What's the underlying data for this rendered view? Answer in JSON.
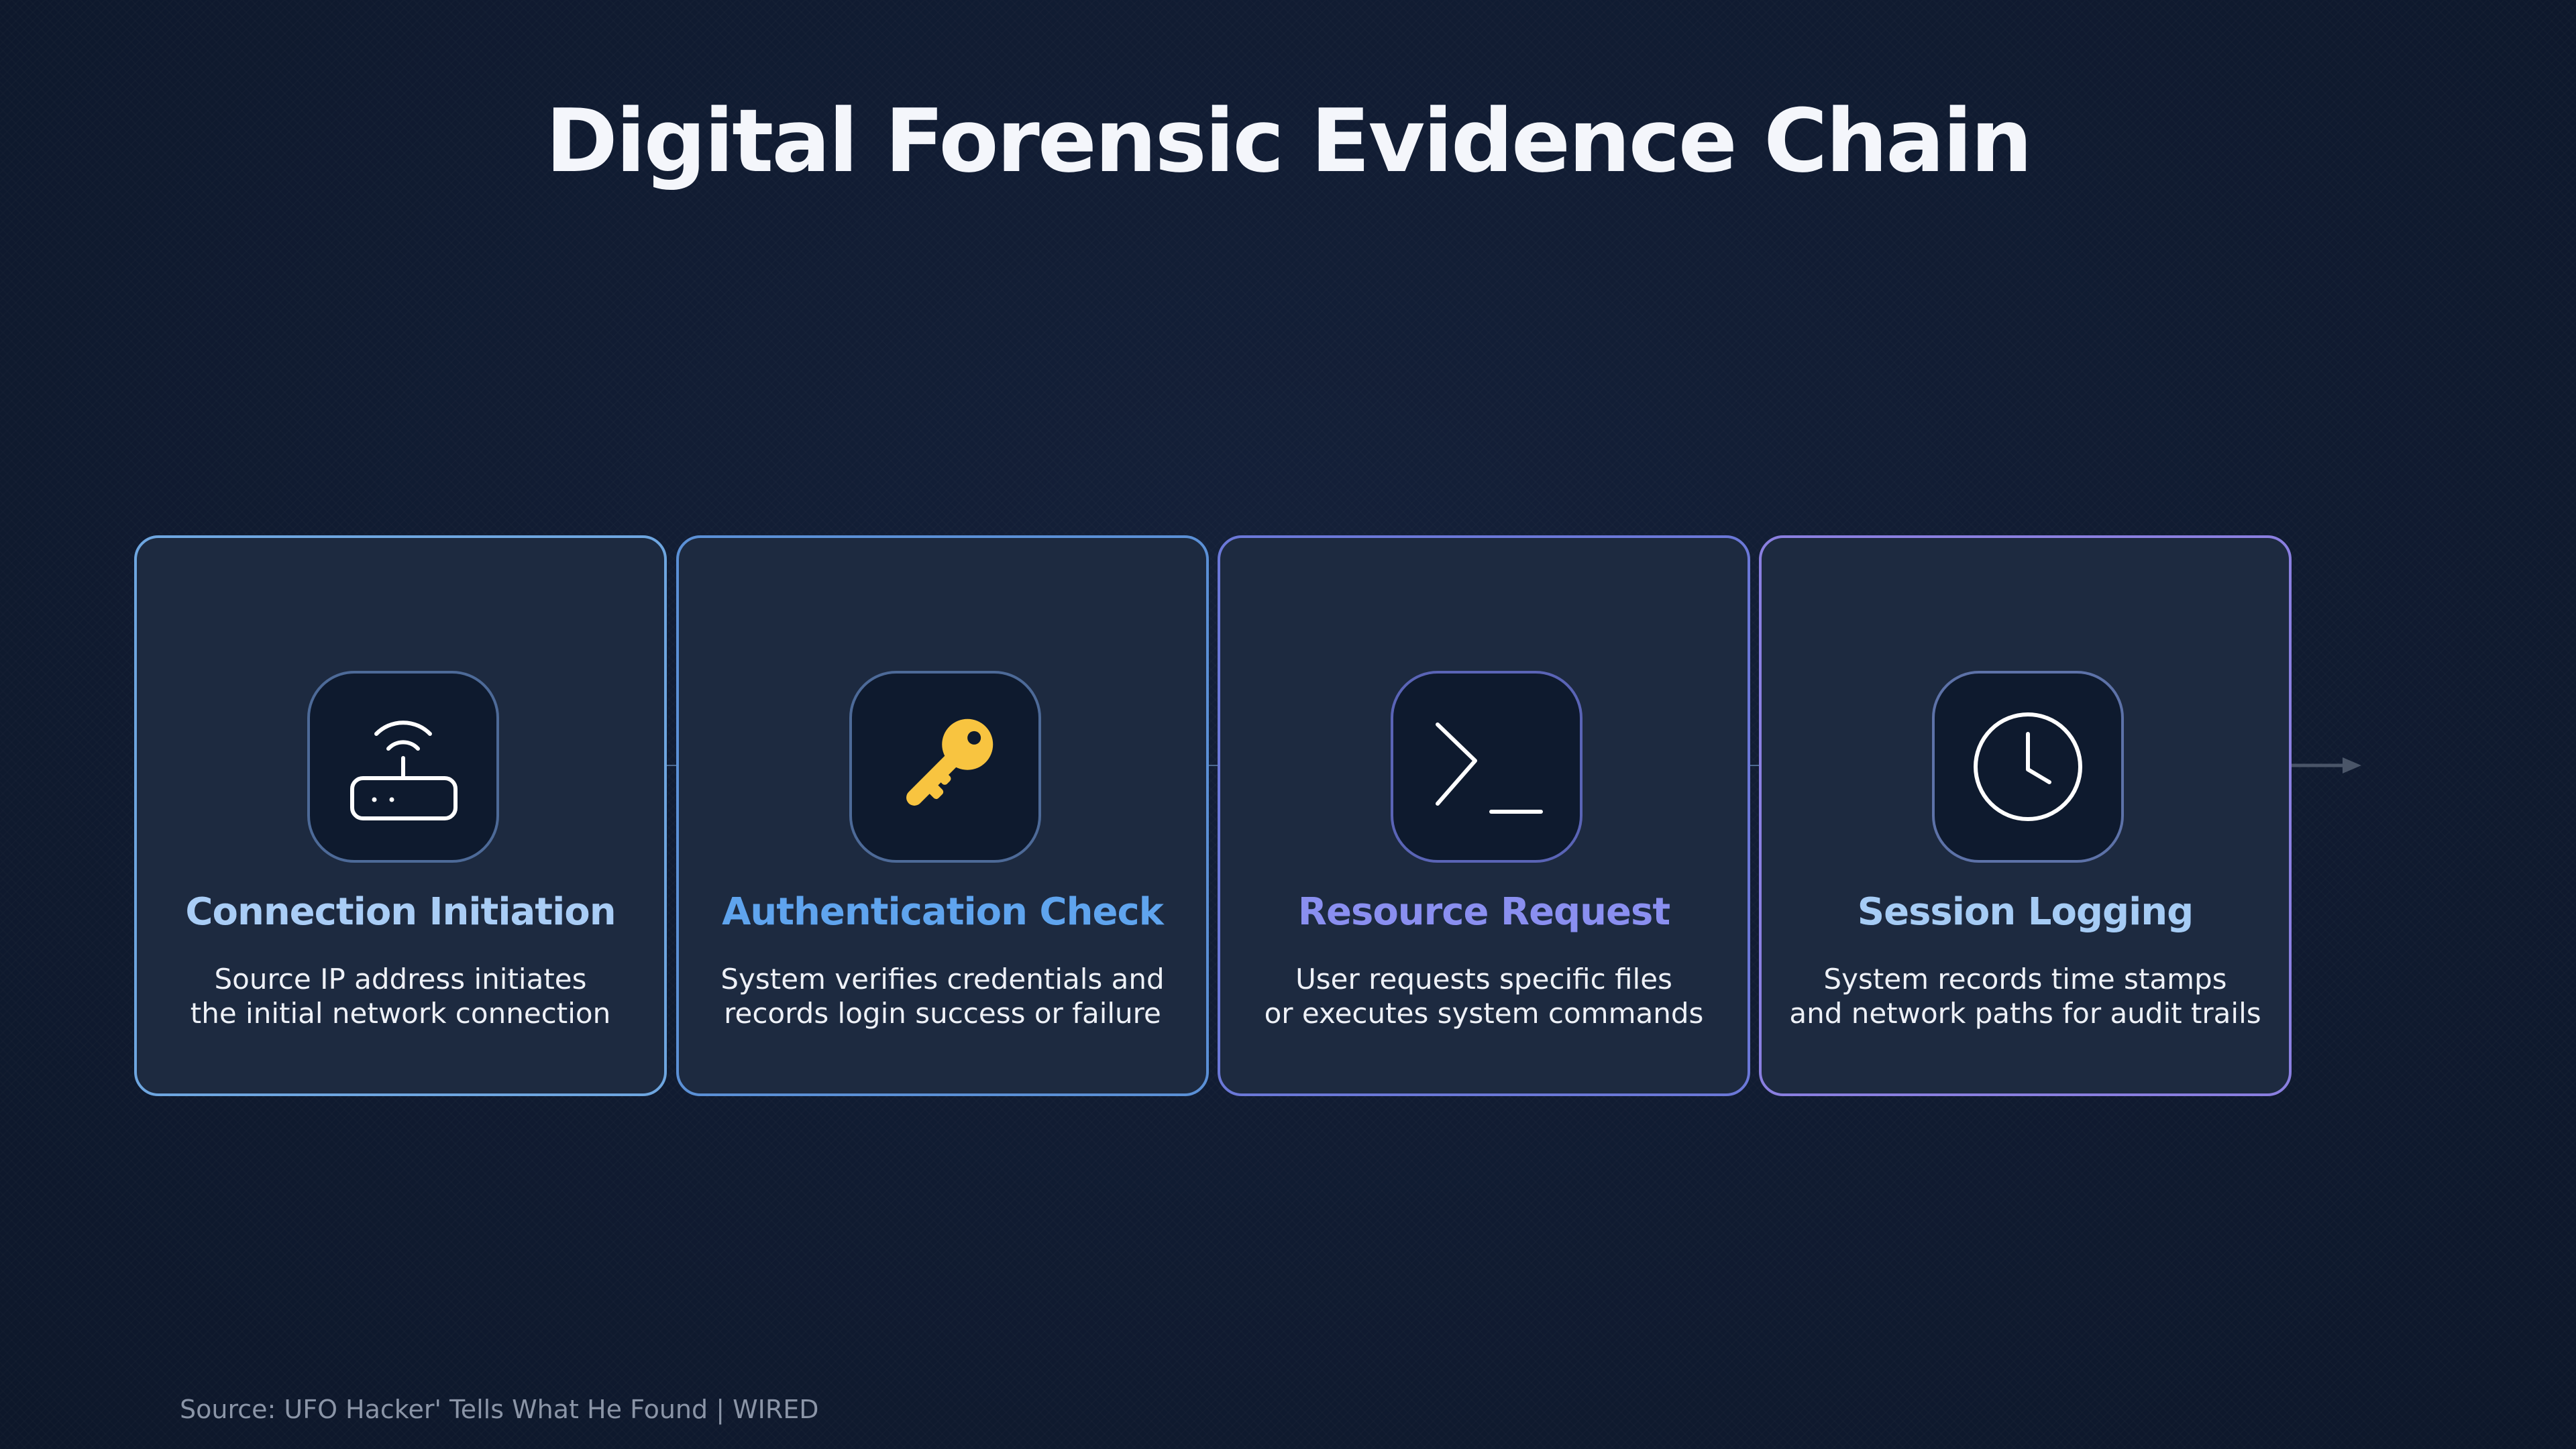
{
  "title": "Digital Forensic Evidence Chain",
  "steps": [
    {
      "icon": "router-icon",
      "title": "Connection Initiation",
      "desc_line1": "Source IP address initiates",
      "desc_line2": "the initial network connection"
    },
    {
      "icon": "key-icon",
      "title": "Authentication Check",
      "desc_line1": "System verifies credentials and",
      "desc_line2": "records login success or failure"
    },
    {
      "icon": "terminal-icon",
      "title": "Resource Request",
      "desc_line1": "User requests specific files",
      "desc_line2": "or executes system commands"
    },
    {
      "icon": "clock-icon",
      "title": "Session Logging",
      "desc_line1": "System records time stamps",
      "desc_line2": "and network paths for audit trails"
    }
  ],
  "source": "Source: UFO Hacker' Tells What He Found | WIRED",
  "colors": {
    "background": "#0f1a2e",
    "card_background": "#1d2a40",
    "key_icon": "#f8c440",
    "title_step_1": "#a9cdf6",
    "title_step_2": "#5fa4ee",
    "title_step_3": "#8a8ff0",
    "title_step_4": "#a6ccf5"
  }
}
